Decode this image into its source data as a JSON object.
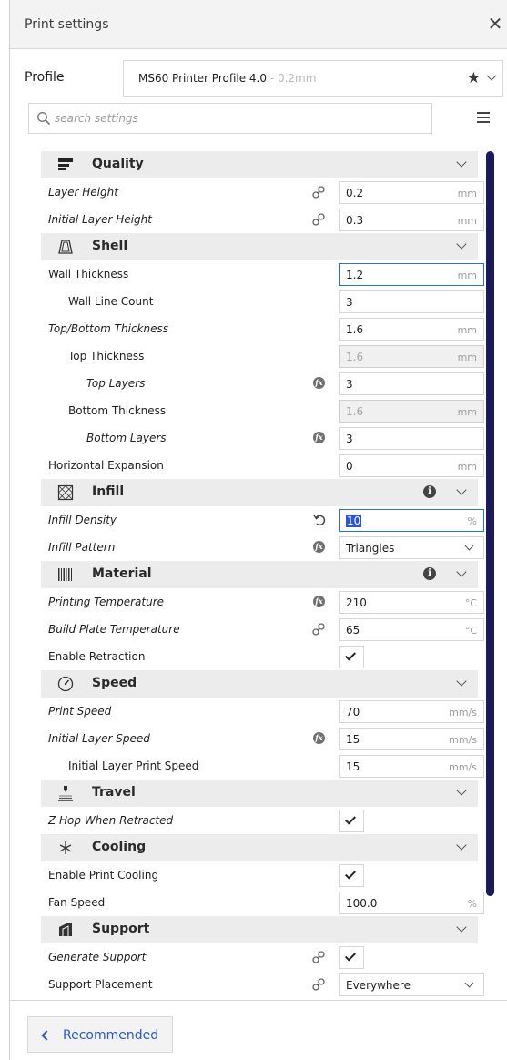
{
  "window": {
    "title": "Print settings",
    "close_glyph": "✕"
  },
  "profile": {
    "label": "Profile",
    "name": "MS60 Printer Profile 4.0",
    "variant": " - 0.2mm",
    "favorite_icon": "star-icon"
  },
  "search": {
    "placeholder": "search settings"
  },
  "categories": {
    "quality": "Quality",
    "shell": "Shell",
    "infill": "Infill",
    "material": "Material",
    "speed": "Speed",
    "travel": "Travel",
    "cooling": "Cooling",
    "support": "Support"
  },
  "settings": {
    "layer_height": {
      "label": "Layer Height",
      "value": "0.2",
      "unit": "mm"
    },
    "initial_layer_height": {
      "label": "Initial Layer Height",
      "value": "0.3",
      "unit": "mm"
    },
    "wall_thickness": {
      "label": "Wall Thickness",
      "value": "1.2",
      "unit": "mm"
    },
    "wall_line_count": {
      "label": "Wall Line Count",
      "value": "3"
    },
    "top_bottom_thickness": {
      "label": "Top/Bottom Thickness",
      "value": "1.6",
      "unit": "mm"
    },
    "top_thickness": {
      "label": "Top Thickness",
      "value": "1.6",
      "unit": "mm"
    },
    "top_layers": {
      "label": "Top Layers",
      "value": "3"
    },
    "bottom_thickness": {
      "label": "Bottom Thickness",
      "value": "1.6",
      "unit": "mm"
    },
    "bottom_layers": {
      "label": "Bottom Layers",
      "value": "3"
    },
    "horizontal_expansion": {
      "label": "Horizontal Expansion",
      "value": "0",
      "unit": "mm"
    },
    "infill_density": {
      "label": "Infill Density",
      "value": "10",
      "unit": "%"
    },
    "infill_pattern": {
      "label": "Infill Pattern",
      "value": "Triangles"
    },
    "printing_temperature": {
      "label": "Printing Temperature",
      "value": "210",
      "unit": "°C"
    },
    "build_plate_temperature": {
      "label": "Build Plate Temperature",
      "value": "65",
      "unit": "°C"
    },
    "enable_retraction": {
      "label": "Enable Retraction",
      "checked": true
    },
    "print_speed": {
      "label": "Print Speed",
      "value": "70",
      "unit": "mm/s"
    },
    "initial_layer_speed": {
      "label": "Initial Layer Speed",
      "value": "15",
      "unit": "mm/s"
    },
    "initial_layer_print_speed": {
      "label": "Initial Layer Print Speed",
      "value": "15",
      "unit": "mm/s"
    },
    "z_hop": {
      "label": "Z Hop When Retracted",
      "checked": true
    },
    "enable_print_cooling": {
      "label": "Enable Print Cooling",
      "checked": true
    },
    "fan_speed": {
      "label": "Fan Speed",
      "value": "100.0",
      "unit": "%"
    },
    "generate_support": {
      "label": "Generate Support",
      "checked": true
    },
    "support_placement": {
      "label": "Support Placement",
      "value": "Everywhere"
    }
  },
  "footer": {
    "recommended_label": "Recommended"
  },
  "colors": {
    "accent": "#2a58c9",
    "scrollbar": "#1a1a5c",
    "category_bg": "#ececec",
    "selection": "#2b55d6"
  }
}
